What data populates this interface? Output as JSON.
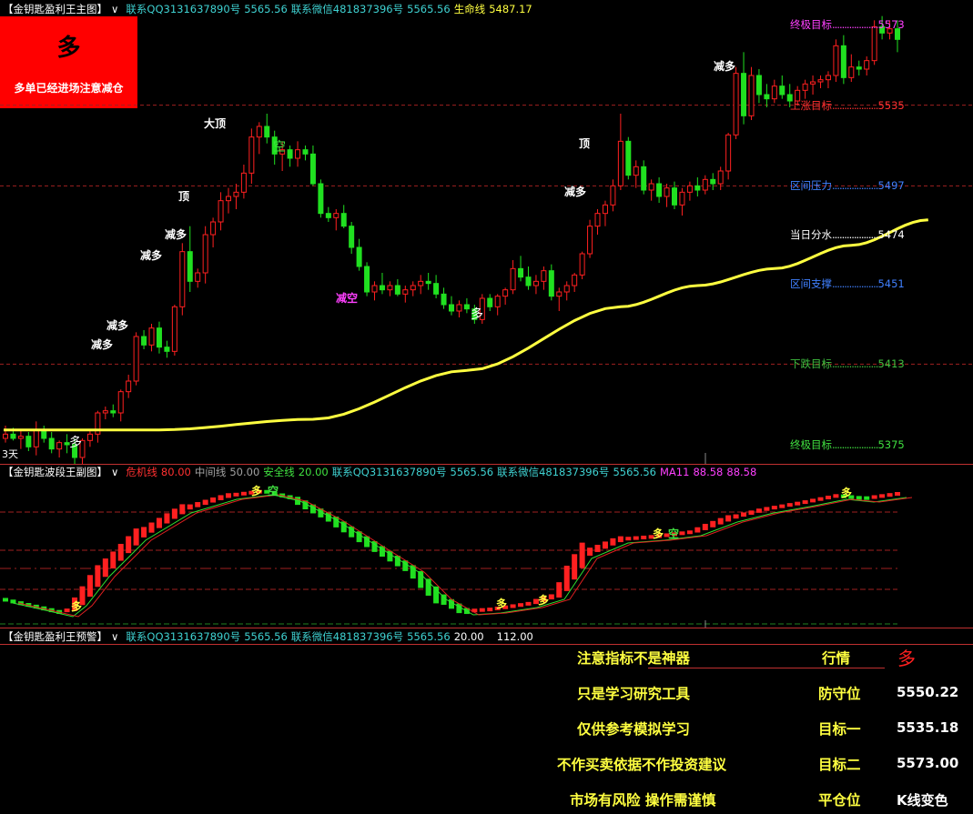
{
  "main_panel": {
    "title": "【金钥匙盈利王主图】",
    "dropdown": "∨",
    "contact_qq": "联系QQ3131637890号",
    "price1": "5565.56",
    "contact_wechat": "联系微信481837396号",
    "price2": "5565.56",
    "life_line_label": "生命线",
    "life_line_value": "5487.17",
    "signal_box_main": "多",
    "signal_box_sub": "多单已经进场注意减仓",
    "period_label": "3天",
    "levels": [
      {
        "label": "终极目标",
        "value": "5573",
        "color": "#ff40ff"
      },
      {
        "label": "上涨目标",
        "value": "5535",
        "color": "#ff3030"
      },
      {
        "label": "区间压力",
        "value": "5497",
        "color": "#4080ff"
      },
      {
        "label": "当日分水",
        "value": "5474",
        "color": "#ffffff"
      },
      {
        "label": "区间支撑",
        "value": "5451",
        "color": "#4080ff"
      },
      {
        "label": "下跌目标",
        "value": "5413",
        "color": "#40c040"
      },
      {
        "label": "终极目标",
        "value": "5375",
        "color": "#40e040"
      }
    ],
    "marks": [
      {
        "text": "多",
        "color": "#ffffff"
      },
      {
        "text": "减多",
        "color": "#ffffff"
      },
      {
        "text": "减多",
        "color": "#ffffff"
      },
      {
        "text": "减多",
        "color": "#ffffff"
      },
      {
        "text": "减多",
        "color": "#ffffff"
      },
      {
        "text": "顶",
        "color": "#ffffff"
      },
      {
        "text": "大顶",
        "color": "#ffffff"
      },
      {
        "text": "空",
        "color": "#40e040"
      },
      {
        "text": "减空",
        "color": "#ff40ff"
      },
      {
        "text": "多",
        "color": "#ffffff"
      },
      {
        "text": "减多",
        "color": "#ffffff"
      },
      {
        "text": "顶",
        "color": "#ffffff"
      },
      {
        "text": "减多",
        "color": "#ffffff"
      }
    ]
  },
  "sub_panel": {
    "title": "【金钥匙波段王副图】",
    "dropdown": "∨",
    "danger_label": "危机线",
    "danger_value": "80.00",
    "mid_label": "中间线",
    "mid_value": "50.00",
    "safe_label": "安全线",
    "safe_value": "20.00",
    "contact_qq": "联系QQ3131637890号",
    "price1": "5565.56",
    "contact_wechat": "联系微信481837396号",
    "price2": "5565.56",
    "ma_label": "MA11",
    "ma_value1": "88.58",
    "ma_value2": "88.58",
    "marks": [
      "多",
      "空",
      "多",
      "多",
      "多",
      "多",
      "空",
      "多"
    ]
  },
  "warn_panel": {
    "title": "【金钥匙盈利王预警】",
    "dropdown": "∨",
    "contact_qq": "联系QQ3131637890号",
    "price1": "5565.56",
    "contact_wechat": "联系微信481837396号",
    "price2": "5565.56",
    "v1": "20.00",
    "v2": "112.00",
    "notes": [
      "注意指标不是神器",
      "只是学习研究工具",
      "仅供参考模拟学习",
      "不作买卖依据不作投资建议",
      "市场有风险 操作需谨慎"
    ],
    "rows": [
      {
        "label": "行情",
        "value": "多"
      },
      {
        "label": "防守位",
        "value": "5550.22"
      },
      {
        "label": "目标一",
        "value": "5535.18"
      },
      {
        "label": "目标二",
        "value": "5573.00"
      },
      {
        "label": "平仓位",
        "value": "K线变色"
      }
    ]
  },
  "colors": {
    "up": "#ff2020",
    "down": "#20e020",
    "life_line": "#ffff40",
    "grid": "#a02020"
  },
  "chart_data": {
    "type": "candlestick",
    "y_range": [
      5360,
      5590
    ],
    "candles_ohlc": [
      [
        5378,
        5384,
        5376,
        5380
      ],
      [
        5380,
        5383,
        5377,
        5378
      ],
      [
        5378,
        5382,
        5373,
        5379
      ],
      [
        5379,
        5381,
        5372,
        5374
      ],
      [
        5374,
        5386,
        5370,
        5382
      ],
      [
        5382,
        5384,
        5376,
        5378
      ],
      [
        5378,
        5381,
        5371,
        5373
      ],
      [
        5373,
        5377,
        5369,
        5376
      ],
      [
        5376,
        5380,
        5371,
        5375
      ],
      [
        5375,
        5378,
        5365,
        5369
      ],
      [
        5369,
        5378,
        5366,
        5377
      ],
      [
        5377,
        5382,
        5374,
        5380
      ],
      [
        5380,
        5391,
        5376,
        5390
      ],
      [
        5390,
        5393,
        5387,
        5391
      ],
      [
        5391,
        5394,
        5388,
        5390
      ],
      [
        5390,
        5401,
        5386,
        5400
      ],
      [
        5400,
        5408,
        5397,
        5405
      ],
      [
        5405,
        5428,
        5403,
        5426
      ],
      [
        5426,
        5429,
        5420,
        5422
      ],
      [
        5422,
        5432,
        5419,
        5430
      ],
      [
        5430,
        5433,
        5418,
        5421
      ],
      [
        5421,
        5424,
        5416,
        5419
      ],
      [
        5419,
        5441,
        5417,
        5440
      ],
      [
        5440,
        5470,
        5436,
        5466
      ],
      [
        5466,
        5478,
        5447,
        5452
      ],
      [
        5452,
        5458,
        5449,
        5456
      ],
      [
        5456,
        5478,
        5451,
        5474
      ],
      [
        5474,
        5482,
        5468,
        5480
      ],
      [
        5480,
        5494,
        5476,
        5490
      ],
      [
        5490,
        5496,
        5484,
        5492
      ],
      [
        5492,
        5498,
        5486,
        5494
      ],
      [
        5494,
        5507,
        5491,
        5503
      ],
      [
        5503,
        5524,
        5498,
        5520
      ],
      [
        5520,
        5527,
        5512,
        5525
      ],
      [
        5525,
        5531,
        5517,
        5520
      ],
      [
        5520,
        5523,
        5507,
        5512
      ],
      [
        5512,
        5518,
        5504,
        5514
      ],
      [
        5514,
        5516,
        5506,
        5510
      ],
      [
        5510,
        5518,
        5506,
        5514
      ],
      [
        5514,
        5516,
        5509,
        5512
      ],
      [
        5512,
        5516,
        5497,
        5498
      ],
      [
        5498,
        5500,
        5482,
        5484
      ],
      [
        5484,
        5487,
        5480,
        5482
      ],
      [
        5482,
        5486,
        5476,
        5484
      ],
      [
        5484,
        5488,
        5477,
        5478
      ],
      [
        5478,
        5480,
        5465,
        5468
      ],
      [
        5468,
        5472,
        5457,
        5459
      ],
      [
        5459,
        5461,
        5445,
        5447
      ],
      [
        5447,
        5452,
        5443,
        5450
      ],
      [
        5450,
        5456,
        5446,
        5448
      ],
      [
        5448,
        5452,
        5445,
        5450
      ],
      [
        5450,
        5453,
        5445,
        5446
      ],
      [
        5446,
        5450,
        5442,
        5448
      ],
      [
        5448,
        5452,
        5445,
        5450
      ],
      [
        5450,
        5455,
        5446,
        5452
      ],
      [
        5452,
        5456,
        5448,
        5451
      ],
      [
        5451,
        5455,
        5444,
        5446
      ],
      [
        5446,
        5449,
        5439,
        5441
      ],
      [
        5441,
        5445,
        5436,
        5438
      ],
      [
        5438,
        5443,
        5435,
        5441
      ],
      [
        5441,
        5444,
        5437,
        5439
      ],
      [
        5439,
        5441,
        5432,
        5434
      ],
      [
        5434,
        5446,
        5432,
        5444
      ],
      [
        5444,
        5446,
        5438,
        5440
      ],
      [
        5440,
        5446,
        5436,
        5445
      ],
      [
        5445,
        5449,
        5441,
        5448
      ],
      [
        5448,
        5462,
        5446,
        5458
      ],
      [
        5458,
        5464,
        5452,
        5454
      ],
      [
        5454,
        5459,
        5448,
        5450
      ],
      [
        5450,
        5455,
        5446,
        5452
      ],
      [
        5452,
        5459,
        5448,
        5457
      ],
      [
        5457,
        5460,
        5443,
        5445
      ],
      [
        5445,
        5449,
        5438,
        5447
      ],
      [
        5447,
        5452,
        5443,
        5450
      ],
      [
        5450,
        5456,
        5447,
        5455
      ],
      [
        5455,
        5466,
        5453,
        5465
      ],
      [
        5465,
        5481,
        5463,
        5478
      ],
      [
        5478,
        5486,
        5474,
        5484
      ],
      [
        5484,
        5490,
        5478,
        5488
      ],
      [
        5488,
        5500,
        5485,
        5497
      ],
      [
        5497,
        5531,
        5495,
        5518
      ],
      [
        5518,
        5520,
        5500,
        5502
      ],
      [
        5502,
        5509,
        5496,
        5506
      ],
      [
        5506,
        5509,
        5493,
        5495
      ],
      [
        5495,
        5500,
        5490,
        5498
      ],
      [
        5498,
        5501,
        5489,
        5492
      ],
      [
        5492,
        5498,
        5487,
        5496
      ],
      [
        5496,
        5499,
        5486,
        5488
      ],
      [
        5488,
        5496,
        5483,
        5494
      ],
      [
        5494,
        5499,
        5490,
        5497
      ],
      [
        5497,
        5501,
        5492,
        5495
      ],
      [
        5495,
        5502,
        5493,
        5500
      ],
      [
        5500,
        5503,
        5495,
        5498
      ],
      [
        5498,
        5506,
        5495,
        5504
      ],
      [
        5504,
        5522,
        5500,
        5521
      ],
      [
        5521,
        5553,
        5519,
        5550
      ],
      [
        5550,
        5560,
        5526,
        5530
      ],
      [
        5530,
        5553,
        5528,
        5549
      ],
      [
        5549,
        5552,
        5536,
        5540
      ],
      [
        5540,
        5545,
        5534,
        5538
      ],
      [
        5538,
        5547,
        5536,
        5544
      ],
      [
        5544,
        5549,
        5538,
        5540
      ],
      [
        5540,
        5545,
        5534,
        5537
      ],
      [
        5537,
        5544,
        5535,
        5542
      ],
      [
        5542,
        5547,
        5538,
        5545
      ],
      [
        5545,
        5549,
        5540,
        5546
      ],
      [
        5546,
        5549,
        5543,
        5547
      ],
      [
        5547,
        5551,
        5543,
        5549
      ],
      [
        5549,
        5566,
        5546,
        5563
      ],
      [
        5563,
        5568,
        5545,
        5548
      ],
      [
        5548,
        5559,
        5546,
        5553
      ],
      [
        5553,
        5556,
        5549,
        5552
      ],
      [
        5552,
        5558,
        5549,
        5556
      ],
      [
        5556,
        5575,
        5554,
        5572
      ],
      [
        5572,
        5577,
        5566,
        5569
      ],
      [
        5569,
        5575,
        5566,
        5571
      ],
      [
        5571,
        5575,
        5560,
        5566
      ]
    ],
    "life_line": [
      [
        0,
        5382
      ],
      [
        20,
        5382
      ],
      [
        40,
        5387
      ],
      [
        60,
        5410
      ],
      [
        80,
        5440
      ],
      [
        90,
        5450
      ],
      [
        100,
        5458
      ],
      [
        110,
        5469
      ],
      [
        120,
        5481
      ]
    ],
    "sub_indicator_range": [
      0,
      112
    ]
  }
}
